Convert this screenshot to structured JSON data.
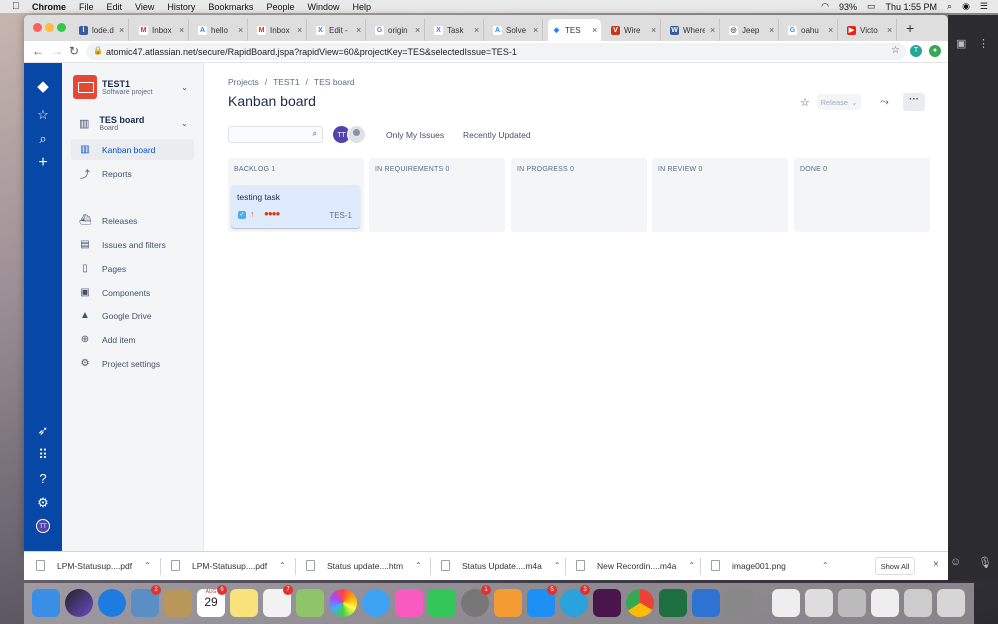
{
  "menubar": {
    "app": "Chrome",
    "items": [
      "File",
      "Edit",
      "View",
      "History",
      "Bookmarks",
      "People",
      "Window",
      "Help"
    ],
    "battery": "93%",
    "clock": "Thu 1:55 PM"
  },
  "tabs": [
    {
      "title": "lode.d",
      "color": "#3a5ba0",
      "glyph": "l"
    },
    {
      "title": "Inbox",
      "color": "#d93025",
      "glyph": "M"
    },
    {
      "title": "hello",
      "color": "#2684ff",
      "glyph": "A"
    },
    {
      "title": "Inbox",
      "color": "#d93025",
      "glyph": "M"
    },
    {
      "title": "Edit -",
      "color": "#2684ff",
      "glyph": "X"
    },
    {
      "title": "origin",
      "color": "#4285f4",
      "glyph": "G"
    },
    {
      "title": "Task",
      "color": "#2684ff",
      "glyph": "X"
    },
    {
      "title": "Solve",
      "color": "#2684ff",
      "glyph": "A"
    },
    {
      "title": "TES",
      "color": "#2684ff",
      "glyph": "◆"
    },
    {
      "title": "Wire",
      "color": "#c7361c",
      "glyph": "V"
    },
    {
      "title": "Where",
      "color": "#3a5ba0",
      "glyph": "W"
    },
    {
      "title": "Jeep",
      "color": "#555555",
      "glyph": "◎"
    },
    {
      "title": "oahu",
      "color": "#4285f4",
      "glyph": "G"
    },
    {
      "title": "Victo",
      "color": "#e62117",
      "glyph": "▶"
    }
  ],
  "address": {
    "url": "atomic47.atlassian.net/secure/RapidBoard.jspa?rapidView=60&projectKey=TES&selectedIssue=TES-1"
  },
  "profiles": [
    "T",
    "●"
  ],
  "sidebar": {
    "project_name": "TEST1",
    "project_type": "Software project",
    "board_name": "TES board",
    "board_type": "Board",
    "items": [
      {
        "label": "Kanban board",
        "icon": "kanban-icon"
      },
      {
        "label": "Reports",
        "icon": "reports-icon"
      },
      {
        "label": "Releases",
        "icon": "releases-icon"
      },
      {
        "label": "Issues and filters",
        "icon": "issues-icon"
      },
      {
        "label": "Pages",
        "icon": "pages-icon"
      },
      {
        "label": "Components",
        "icon": "components-icon"
      },
      {
        "label": "Google Drive",
        "icon": "google-drive-icon"
      },
      {
        "label": "Add item",
        "icon": "add-item-icon"
      },
      {
        "label": "Project settings",
        "icon": "settings-icon"
      }
    ]
  },
  "globalnav": {
    "avatar": "TT"
  },
  "main": {
    "breadcrumbs": [
      "Projects",
      "/",
      "TEST1",
      "/",
      "TES board"
    ],
    "title": "Kanban board",
    "release_label": "Release",
    "avatar": "TT",
    "quick_filters": [
      "Only My Issues",
      "Recently Updated"
    ],
    "columns": [
      {
        "title": "BACKLOG 1"
      },
      {
        "title": "IN REQUIREMENTS 0"
      },
      {
        "title": "IN PROGRESS 0"
      },
      {
        "title": "IN REVIEW 0"
      },
      {
        "title": "DONE 0"
      }
    ],
    "card": {
      "summary": "testing task",
      "key": "TES-1"
    }
  },
  "downloads": [
    {
      "name": "LPM-Statusup....pdf"
    },
    {
      "name": "LPM-Statusup....pdf"
    },
    {
      "name": "Status update....htm"
    },
    {
      "name": "Status Update....m4a"
    },
    {
      "name": "New Recordin....m4a"
    },
    {
      "name": "image001.png"
    }
  ],
  "downloads_show_all": "Show All",
  "dock": {
    "calendar_month": "AUG",
    "calendar_day": "29",
    "badges": [
      "2",
      "6",
      "7",
      "1",
      "5",
      "3"
    ]
  },
  "colors": {
    "global_nav": "#0747a6",
    "sidebar_bg": "#f4f5f7",
    "card_bg": "#deebff",
    "accent": "#0052cc"
  }
}
